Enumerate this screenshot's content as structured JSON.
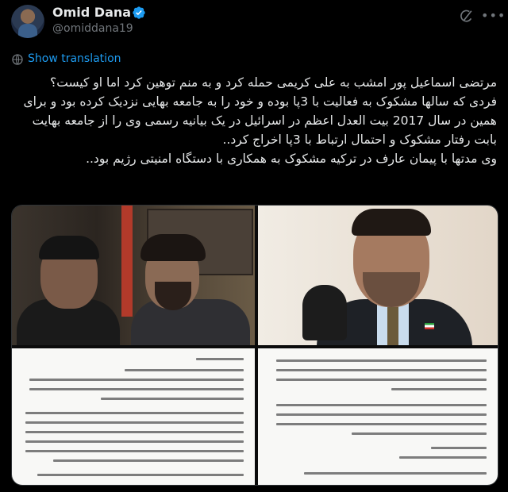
{
  "author": {
    "name": "Omid Dana",
    "handle": "@omiddana19",
    "verified": true
  },
  "header": {
    "grok_icon": "grok-icon",
    "more_icon": "more-icon"
  },
  "translate": {
    "label": "Show translation",
    "icon": "globe-icon"
  },
  "tweet": {
    "paragraphs": [
      "مرتضی اسماعیل پور امشب به علی کریمی حمله کرد و به منم توهین کرد اما او کیست؟",
      "فردی که سالها مشکوک به فعالیت با 3پا بوده و خود را به جامعه بهایی نزدیک کرده بود و برای همین در سال 2017 بیت العدل اعظم در اسرائیل در یک بیانیه رسمی وی را از جامعه بهایت بابت رفتار مشکوک و احتمال ارتباط با 3پا اخراج کرد..",
      "وی مدتها با پیمان عارف در ترکیه مشکوک به همکاری با دستگاه امنیتی رژیم بود.."
    ]
  },
  "media": {
    "images": [
      "photo-two-men",
      "photo-man-with-microphone",
      "document-page-left",
      "document-page-right"
    ]
  },
  "colors": {
    "background": "#000000",
    "text": "#e7e9ea",
    "muted": "#71767b",
    "accent": "#1d9bf0"
  }
}
